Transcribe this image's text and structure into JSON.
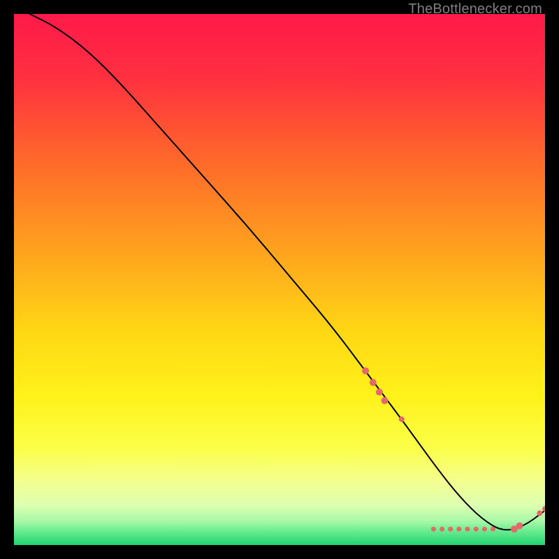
{
  "attribution": "TheBottlenecker.com",
  "chart_data": {
    "type": "line",
    "title": "",
    "xlabel": "",
    "ylabel": "",
    "xlim": [
      0,
      100
    ],
    "ylim": [
      0,
      100
    ],
    "gradient": {
      "top_color": "#ff1a4a",
      "mid_colors": [
        "#ff5a2d",
        "#ffc414",
        "#fff21a",
        "#faff63",
        "#d4ffb0"
      ],
      "bottom_color": "#20e47a"
    },
    "series": [
      {
        "name": "curve",
        "x": [
          3,
          8,
          14,
          20,
          28,
          36,
          44,
          52,
          60,
          66,
          72,
          76,
          80,
          84,
          88,
          92,
          96,
          100
        ],
        "y": [
          100,
          97.5,
          93,
          87,
          78,
          69,
          60,
          50.5,
          41,
          33,
          25,
          19.5,
          14,
          9,
          5,
          2.5,
          3.5,
          6.5
        ]
      }
    ],
    "markers": {
      "cluster_upper": {
        "x_range": [
          66,
          70
        ],
        "y_range": [
          26,
          33
        ],
        "count": 4,
        "color": "#e46a6a",
        "points": [
          {
            "x": 66.2,
            "y": 32.8,
            "r": 5
          },
          {
            "x": 67.6,
            "y": 30.6,
            "r": 5
          },
          {
            "x": 68.8,
            "y": 28.8,
            "r": 5
          },
          {
            "x": 69.8,
            "y": 27.2,
            "r": 5
          }
        ]
      },
      "cluster_mid_single": {
        "x": 73,
        "y": 23.7,
        "r": 4,
        "color": "#e46a6a"
      },
      "cluster_bottom_flat": {
        "x_range": [
          79,
          91
        ],
        "y": 3,
        "color": "#e46a6a",
        "label_text_approx": "",
        "points": [
          {
            "x": 79.0,
            "r": 3.5
          },
          {
            "x": 80.6,
            "r": 3.5
          },
          {
            "x": 82.2,
            "r": 3.5
          },
          {
            "x": 83.8,
            "r": 3.5
          },
          {
            "x": 85.4,
            "r": 3.5
          },
          {
            "x": 87.0,
            "r": 3.5
          },
          {
            "x": 88.6,
            "r": 3.5
          },
          {
            "x": 90.2,
            "r": 3.5
          }
        ]
      },
      "cluster_right_rise": {
        "color": "#e46a6a",
        "points": [
          {
            "x": 94.2,
            "y": 3.0,
            "r": 5
          },
          {
            "x": 95.2,
            "y": 3.6,
            "r": 5
          },
          {
            "x": 99.0,
            "y": 6.0,
            "r": 4
          },
          {
            "x": 100.0,
            "y": 6.8,
            "r": 4
          }
        ]
      }
    }
  }
}
